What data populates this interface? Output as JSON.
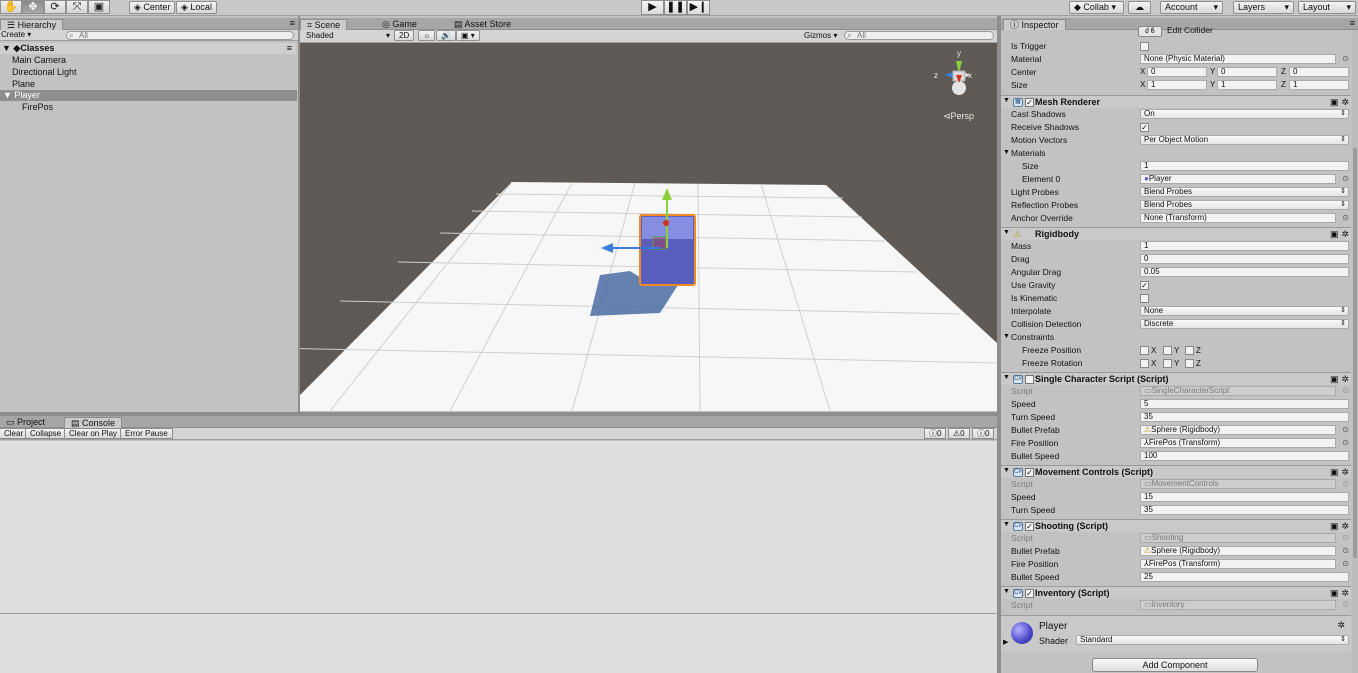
{
  "toolbar": {
    "tools": [
      "hand-icon",
      "move-icon",
      "rotate-icon",
      "scale-icon",
      "rect-icon"
    ],
    "pivot": "Center",
    "space": "Local",
    "collab": "Collab",
    "account": "Account",
    "layers": "Layers",
    "layout": "Layout"
  },
  "hierarchy": {
    "tab": "Hierarchy",
    "create": "Create",
    "search_placeholder": "All",
    "scene_name": "Classes",
    "items": [
      "Main Camera",
      "Directional Light",
      "Plane",
      "Player",
      "FirePos"
    ]
  },
  "scene_view": {
    "tabs": [
      "Scene",
      "Game",
      "Asset Store"
    ],
    "shading": "Shaded",
    "mode_2d": "2D",
    "gizmos": "Gizmos",
    "search_placeholder": "All",
    "persp": "Persp",
    "gizmo_y": "y",
    "gizmo_x": "x",
    "colors": {
      "background": "#5f5a55",
      "ground": "#f7f7f7",
      "cube": "#6e6bd6",
      "selection": "#f08a24"
    }
  },
  "console": {
    "tabs": [
      "Project",
      "Console"
    ],
    "buttons": [
      "Clear",
      "Collapse",
      "Clear on Play",
      "Error Pause"
    ],
    "counts": [
      "0",
      "0",
      "0"
    ]
  },
  "inspector": {
    "tab": "Inspector",
    "collider": {
      "cut_label": "Edit Collider",
      "is_trigger": "Is Trigger",
      "material_label": "Material",
      "material_value": "None (Physic Material)",
      "center_label": "Center",
      "center": [
        "0",
        "0",
        "0"
      ],
      "size_label": "Size",
      "size": [
        "1",
        "1",
        "1"
      ]
    },
    "mesh_renderer": {
      "title": "Mesh Renderer",
      "cast_shadows": "Cast Shadows",
      "cast_shadows_value": "On",
      "receive_shadows": "Receive Shadows",
      "motion_vectors": "Motion Vectors",
      "motion_vectors_value": "Per Object Motion",
      "materials": "Materials",
      "size": "Size",
      "size_value": "1",
      "element0": "Element 0",
      "element0_value": "Player",
      "light_probes": "Light Probes",
      "light_probes_value": "Blend Probes",
      "reflection_probes": "Reflection Probes",
      "reflection_probes_value": "Blend Probes",
      "anchor_override": "Anchor Override",
      "anchor_override_value": "None (Transform)"
    },
    "rigidbody": {
      "title": "Rigidbody",
      "mass": "Mass",
      "mass_value": "1",
      "drag": "Drag",
      "drag_value": "0",
      "angular_drag": "Angular Drag",
      "angular_drag_value": "0.05",
      "use_gravity": "Use Gravity",
      "is_kinematic": "Is Kinematic",
      "interpolate": "Interpolate",
      "interpolate_value": "None",
      "collision": "Collision Detection",
      "collision_value": "Discrete",
      "constraints": "Constraints",
      "freeze_position": "Freeze Position",
      "freeze_rotation": "Freeze Rotation",
      "axes": [
        "X",
        "Y",
        "Z"
      ]
    },
    "single_char": {
      "title": "Single Character Script (Script)",
      "script": "Script",
      "script_value": "SingleCharacterScript",
      "speed": "Speed",
      "speed_value": "5",
      "turn_speed": "Turn Speed",
      "turn_speed_value": "35",
      "bullet_prefab": "Bullet Prefab",
      "bullet_prefab_value": "Sphere (Rigidbody)",
      "fire_position": "Fire Position",
      "fire_position_value": "FirePos (Transform)",
      "bullet_speed": "Bullet Speed",
      "bullet_speed_value": "100"
    },
    "movement": {
      "title": "Movement Controls (Script)",
      "script": "Script",
      "script_value": "MovementControls",
      "speed": "Speed",
      "speed_value": "15",
      "turn_speed": "Turn Speed",
      "turn_speed_value": "35"
    },
    "shooting": {
      "title": "Shooting (Script)",
      "script": "Script",
      "script_value": "Shooting",
      "bullet_prefab": "Bullet Prefab",
      "bullet_prefab_value": "Sphere (Rigidbody)",
      "fire_position": "Fire Position",
      "fire_position_value": "FirePos (Transform)",
      "bullet_speed": "Bullet Speed",
      "bullet_speed_value": "25"
    },
    "inventory": {
      "title": "Inventory (Script)",
      "script": "Script",
      "script_value": "Inventory"
    },
    "material": {
      "name": "Player",
      "shader_label": "Shader",
      "shader_value": "Standard"
    },
    "add_component": "Add Component"
  }
}
